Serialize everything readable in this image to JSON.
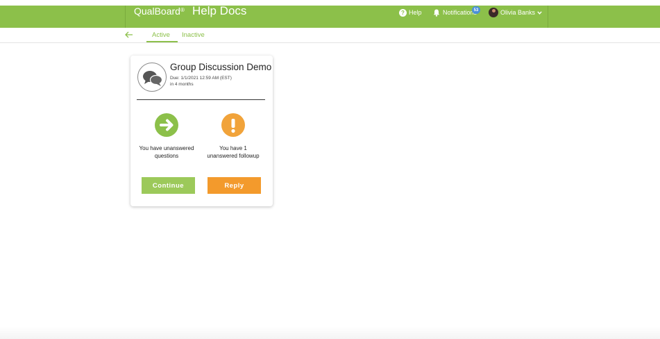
{
  "header": {
    "brand": "QualBoard",
    "brand_mark": "®",
    "page_title": "Help Docs",
    "help_label": "Help",
    "notifications_label": "Notifications",
    "notifications_count": "53",
    "user_name": "Olivia Banks"
  },
  "tabs": {
    "active_label": "Active",
    "inactive_label": "Inactive"
  },
  "card": {
    "title": "Group Discussion Demo",
    "due": "Due: 1/1/2021 12:59 AM (EST)",
    "relative": "in 4 months",
    "left_status": "You have unanswered questions",
    "right_status": "You have 1 unanswered followup",
    "continue_label": "Continue",
    "reply_label": "Reply"
  },
  "colors": {
    "brand_green": "#8cc04a",
    "reply_orange": "#f39a2c",
    "badge_blue": "#4a90d9"
  },
  "icons": [
    "back-arrow-icon",
    "help-icon",
    "bell-icon",
    "chevron-down-icon",
    "chat-bubbles-icon",
    "arrow-right-icon",
    "exclamation-icon"
  ]
}
